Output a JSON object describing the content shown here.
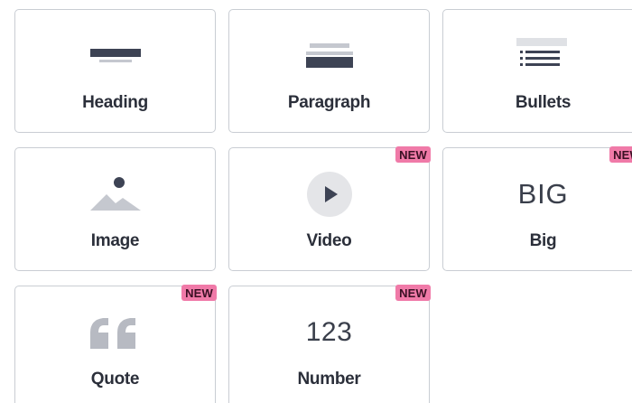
{
  "tiles": [
    {
      "label": "Heading",
      "icon": "heading-icon",
      "badge": ""
    },
    {
      "label": "Paragraph",
      "icon": "paragraph-icon",
      "badge": ""
    },
    {
      "label": "Bullets",
      "icon": "bullets-icon",
      "badge": ""
    },
    {
      "label": "Image",
      "icon": "image-icon",
      "badge": ""
    },
    {
      "label": "Video",
      "icon": "video-icon",
      "badge": "NEW"
    },
    {
      "label": "Big",
      "icon": "big-text-icon",
      "icon_text": "BIG",
      "badge": "NEW"
    },
    {
      "label": "Quote",
      "icon": "quote-icon",
      "badge": "NEW"
    },
    {
      "label": "Number",
      "icon": "number-icon",
      "icon_text": "123",
      "badge": "NEW"
    }
  ],
  "colors": {
    "icon_dark": "#3d4354",
    "icon_light": "#c5c8cf",
    "badge": "#f07aa8",
    "border": "#c9cdd3",
    "label": "#2b2f3a"
  }
}
